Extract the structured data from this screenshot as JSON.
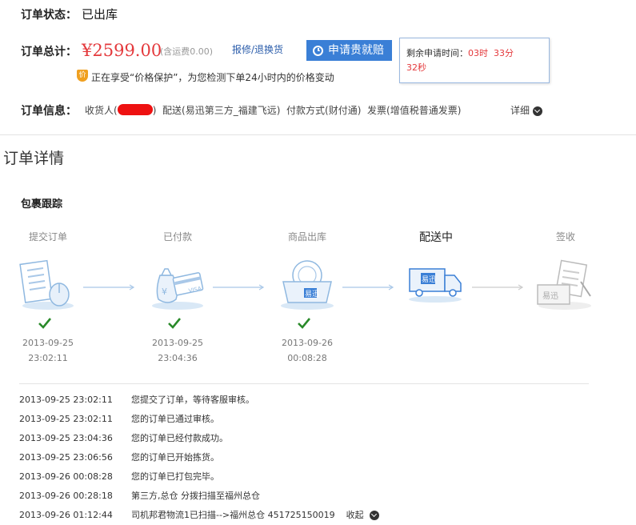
{
  "order_status": {
    "label": "订单状态：",
    "value": "已出库"
  },
  "order_total": {
    "label": "订单总计：",
    "price": "¥2599.00",
    "fee": "(含运费0.00)",
    "repair_link": "报修/退换货",
    "claim_button": "申请贵就赔",
    "popup": {
      "prefix": "剩余申请时间：",
      "hours": "03时",
      "minutes": "33分",
      "seconds": "32秒"
    }
  },
  "price_protect": {
    "icon_text": "价",
    "text": "正在享受“价格保护”，为您检测下单24小时内的价格变动"
  },
  "order_info": {
    "label": "订单信息：",
    "receiver_prefix": "收货人(",
    "receiver_suffix": ")",
    "delivery": "配送(易迅第三方_福建飞远)",
    "payment": "付款方式(财付通)",
    "invoice": "发票(增值税普通发票)",
    "detail": "详细"
  },
  "detail_title": "订单详情",
  "tracking": {
    "title": "包裹跟踪",
    "steps": [
      {
        "label": "提交订单",
        "date": "2013-09-25",
        "time": "23:02:11"
      },
      {
        "label": "已付款",
        "date": "2013-09-25",
        "time": "23:04:36"
      },
      {
        "label": "商品出库",
        "date": "2013-09-26",
        "time": "00:08:28"
      },
      {
        "label": "配送中",
        "date": "",
        "time": ""
      },
      {
        "label": "签收",
        "date": "",
        "time": ""
      }
    ],
    "brand": "易迅"
  },
  "logs": [
    {
      "time": "2013-09-25 23:02:11",
      "text": "您提交了订单，等待客服审核。"
    },
    {
      "time": "2013-09-25 23:02:11",
      "text": "您的订单已通过审核。"
    },
    {
      "time": "2013-09-25 23:04:36",
      "text": "您的订单已经付款成功。"
    },
    {
      "time": "2013-09-25 23:06:56",
      "text": "您的订单已开始拣货。"
    },
    {
      "time": "2013-09-26 00:08:28",
      "text": "您的订单已打包完毕。"
    },
    {
      "time": "2013-09-26 00:28:18",
      "text": "第三方,总仓 分拨扫描至福州总仓"
    },
    {
      "time": "2013-09-26 01:12:44",
      "text": "司机邦君物流1已扫描-->福州总仓 451725150019"
    }
  ],
  "collapse": "收起",
  "colors": {
    "accent": "#3a7fd6",
    "price": "#e4393c",
    "check": "#2a8a2a"
  }
}
